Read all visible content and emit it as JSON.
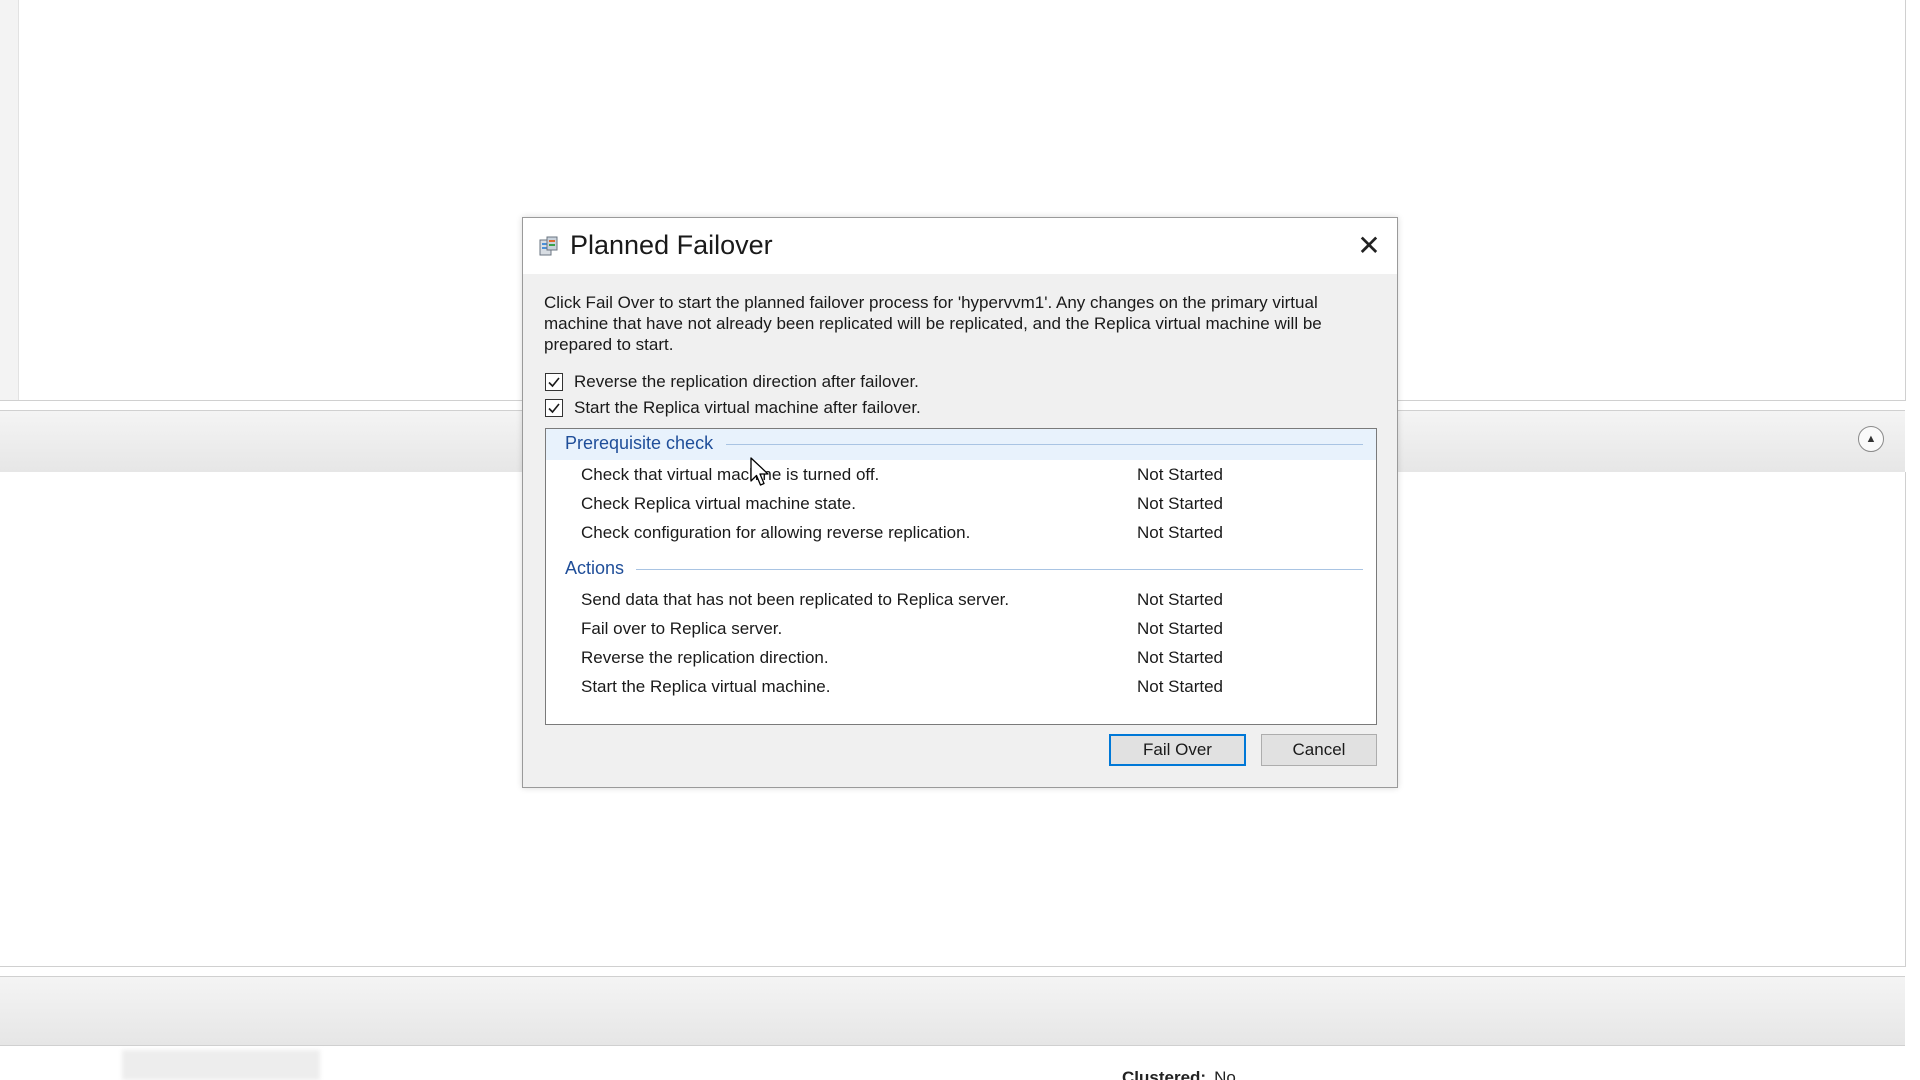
{
  "background": {
    "collapse_glyph": "▲",
    "clustered_label": "Clustered:",
    "clustered_value": "No"
  },
  "dialog": {
    "title": "Planned Failover",
    "icon": "failover-icon",
    "close_glyph": "✕",
    "description": "Click Fail Over to start the planned failover process for 'hypervvm1'. Any changes on the primary virtual machine that have not already been replicated will be replicated, and the Replica virtual machine will be prepared to start.",
    "options": [
      {
        "label": "Reverse the replication direction after failover.",
        "checked": true
      },
      {
        "label": "Start the Replica virtual machine after failover.",
        "checked": true
      }
    ],
    "prerequisite": {
      "title": "Prerequisite check",
      "steps": [
        {
          "label": "Check that virtual machine is turned off.",
          "status": "Not Started"
        },
        {
          "label": "Check Replica virtual machine state.",
          "status": "Not Started"
        },
        {
          "label": "Check configuration for allowing reverse replication.",
          "status": "Not Started"
        }
      ]
    },
    "actions": {
      "title": "Actions",
      "steps": [
        {
          "label": "Send data that has not been replicated to Replica server.",
          "status": "Not Started"
        },
        {
          "label": "Fail over to Replica server.",
          "status": "Not Started"
        },
        {
          "label": "Reverse the replication direction.",
          "status": "Not Started"
        },
        {
          "label": "Start the Replica virtual machine.",
          "status": "Not Started"
        }
      ]
    },
    "buttons": {
      "fail_over": "Fail Over",
      "cancel": "Cancel"
    },
    "colors": {
      "section_title": "#1f4e99",
      "primary_border": "#0078d7"
    }
  }
}
